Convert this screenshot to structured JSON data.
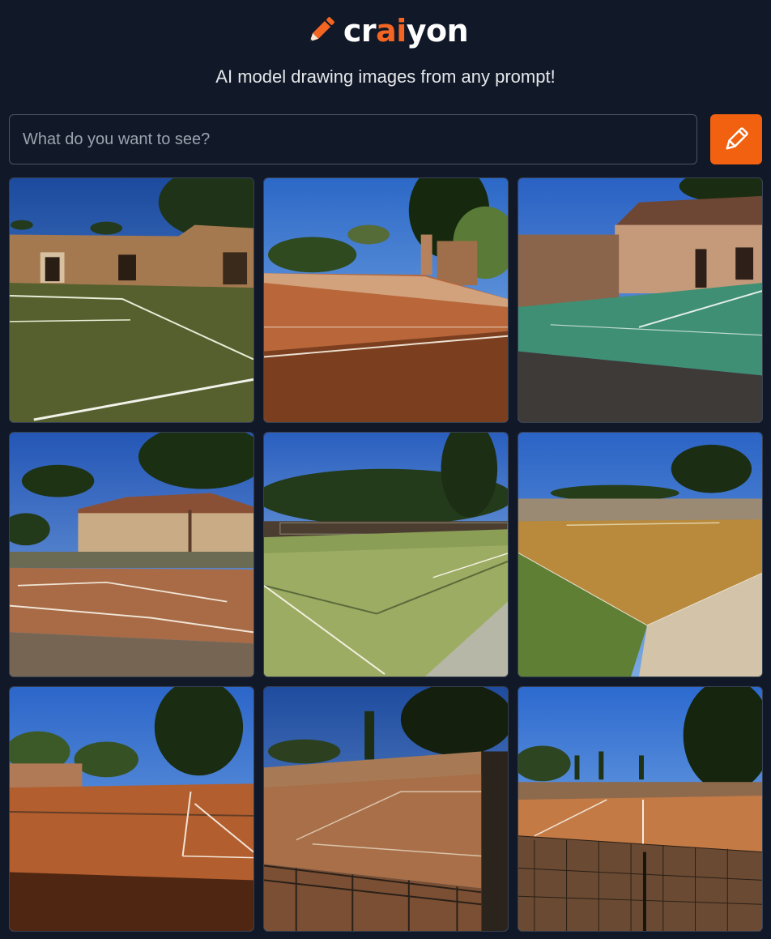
{
  "brand": {
    "name_prefix": "cr",
    "name_accent": "ai",
    "name_suffix": "yon",
    "logo_icon": "pencil-icon",
    "accent_color": "#f26522"
  },
  "tagline": "AI model drawing images from any prompt!",
  "search": {
    "placeholder": "What do you want to see?",
    "value": "",
    "button_icon": "pencil-icon",
    "button_color": "#f1610f"
  },
  "gallery": {
    "images": [
      {
        "subject": "green tennis court with ruined stone walls"
      },
      {
        "subject": "clay tennis court beside stone ruins and trees"
      },
      {
        "subject": "teal tennis court beside stone building"
      },
      {
        "subject": "clay court in front of stone farmhouse"
      },
      {
        "subject": "grass tennis court with net and cypress trees"
      },
      {
        "subject": "ochre court surrounded by stone wall"
      },
      {
        "subject": "clay court with net shadow and trees"
      },
      {
        "subject": "clay court with fence and cypress trees"
      },
      {
        "subject": "clay court with net in foreground"
      }
    ]
  }
}
